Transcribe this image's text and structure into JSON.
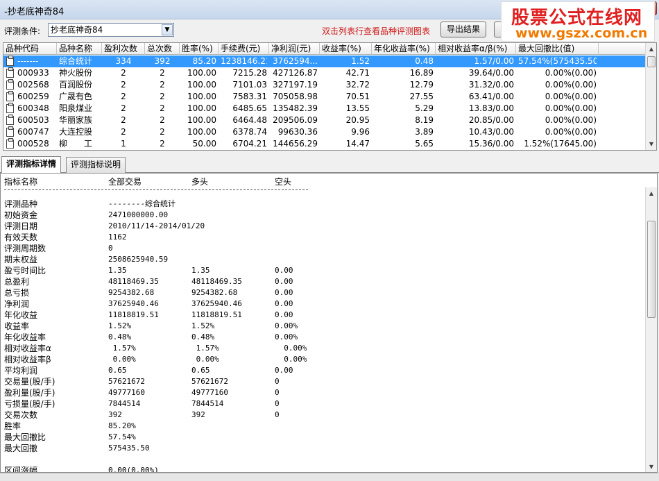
{
  "window": {
    "title": "-抄老底神奇84"
  },
  "watermark": {
    "line1": "股票公式在线网",
    "line2": "www.gszx.com.cn"
  },
  "toolbar": {
    "condition_label": "评测条件:",
    "condition_value": "抄老底神奇84",
    "hint": "双击列表行查看品种评测图表",
    "export_label": "导出结果"
  },
  "grid": {
    "headers": [
      "品种代码",
      "品种名称",
      "盈利次数",
      "总次数",
      "胜率(%)",
      "手续费(元)",
      "净利润(元)",
      "收益率(%)",
      "年化收益率(%)",
      "相对收益率α/β(%)",
      "最大回撤比(值)"
    ],
    "rows": [
      {
        "code": "-------",
        "name": "综合统计",
        "wins": "334",
        "total": "392",
        "rate": "85.20",
        "fee": "1238146.21",
        "profit": "3762594...",
        "ret": "1.52",
        "annual": "0.48",
        "rel": "1.57/0.00",
        "dd": "57.54%(575435.50)",
        "selected": true
      },
      {
        "code": "000933",
        "name": "神火股份",
        "wins": "2",
        "total": "2",
        "rate": "100.00",
        "fee": "7215.28",
        "profit": "427126.87",
        "ret": "42.71",
        "annual": "16.89",
        "rel": "39.64/0.00",
        "dd": "0.00%(0.00)"
      },
      {
        "code": "002568",
        "name": "百润股份",
        "wins": "2",
        "total": "2",
        "rate": "100.00",
        "fee": "7101.03",
        "profit": "327197.19",
        "ret": "32.72",
        "annual": "12.79",
        "rel": "31.32/0.00",
        "dd": "0.00%(0.00)"
      },
      {
        "code": "600259",
        "name": "广晟有色",
        "wins": "2",
        "total": "2",
        "rate": "100.00",
        "fee": "7583.31",
        "profit": "705058.98",
        "ret": "70.51",
        "annual": "27.55",
        "rel": "63.41/0.00",
        "dd": "0.00%(0.00)"
      },
      {
        "code": "600348",
        "name": "阳泉煤业",
        "wins": "2",
        "total": "2",
        "rate": "100.00",
        "fee": "6485.65",
        "profit": "135482.39",
        "ret": "13.55",
        "annual": "5.29",
        "rel": "13.83/0.00",
        "dd": "0.00%(0.00)"
      },
      {
        "code": "600503",
        "name": "华丽家族",
        "wins": "2",
        "total": "2",
        "rate": "100.00",
        "fee": "6464.48",
        "profit": "209506.09",
        "ret": "20.95",
        "annual": "8.19",
        "rel": "20.85/0.00",
        "dd": "0.00%(0.00)"
      },
      {
        "code": "600747",
        "name": "大连控股",
        "wins": "2",
        "total": "2",
        "rate": "100.00",
        "fee": "6378.74",
        "profit": "99630.36",
        "ret": "9.96",
        "annual": "3.89",
        "rel": "10.43/0.00",
        "dd": "0.00%(0.00)"
      },
      {
        "code": "000528",
        "name": "柳　　工",
        "wins": "1",
        "total": "2",
        "rate": "50.00",
        "fee": "6704.21",
        "profit": "144656.29",
        "ret": "14.47",
        "annual": "5.65",
        "rel": "15.36/0.00",
        "dd": "1.52%(17645.00)"
      }
    ]
  },
  "tabs": [
    {
      "label": "评测指标详情",
      "active": true
    },
    {
      "label": "评测指标说明",
      "active": false
    }
  ],
  "detail": {
    "headers": [
      "指标名称",
      "全部交易",
      "多头",
      "空头"
    ],
    "rows": [
      {
        "name": "评测品种",
        "all": "--------综合统计",
        "long": "",
        "short": ""
      },
      {
        "name": "初始资金",
        "all": "2471000000.00",
        "long": "",
        "short": ""
      },
      {
        "name": "评测日期",
        "all": "2010/11/14-2014/01/20",
        "long": "",
        "short": ""
      },
      {
        "name": "有效天数",
        "all": "1162",
        "long": "",
        "short": ""
      },
      {
        "name": "评测周期数",
        "all": "0",
        "long": "",
        "short": ""
      },
      {
        "name": "期末权益",
        "all": "2508625940.59",
        "long": "",
        "short": ""
      },
      {
        "name": "盈亏时间比",
        "all": "1.35",
        "long": "1.35",
        "short": "0.00"
      },
      {
        "name": "总盈利",
        "all": "48118469.35",
        "long": "48118469.35",
        "short": "0.00"
      },
      {
        "name": "总亏损",
        "all": "9254382.68",
        "long": "9254382.68",
        "short": "0.00"
      },
      {
        "name": "净利润",
        "all": "37625940.46",
        "long": "37625940.46",
        "short": "0.00"
      },
      {
        "name": "年化收益",
        "all": "11818819.51",
        "long": "11818819.51",
        "short": "0.00"
      },
      {
        "name": "收益率",
        "all": "1.52%",
        "long": "1.52%",
        "short": "0.00%"
      },
      {
        "name": "年化收益率",
        "all": "0.48%",
        "long": "0.48%",
        "short": "0.00%"
      },
      {
        "name": "相对收益率α",
        "all": " 1.57%",
        "long": " 1.57%",
        "short": "  0.00%"
      },
      {
        "name": "相对收益率β",
        "all": " 0.00%",
        "long": " 0.00%",
        "short": "  0.00%"
      },
      {
        "name": "平均利润",
        "all": "0.65",
        "long": "0.65",
        "short": "0.00"
      },
      {
        "name": "交易量(股/手)",
        "all": "57621672",
        "long": "57621672",
        "short": "0"
      },
      {
        "name": "盈利量(股/手)",
        "all": "49777160",
        "long": "49777160",
        "short": "0"
      },
      {
        "name": "亏损量(股/手)",
        "all": "7844514",
        "long": "7844514",
        "short": "0"
      },
      {
        "name": "交易次数",
        "all": "392",
        "long": "392",
        "short": "0"
      },
      {
        "name": "胜率",
        "all": "85.20%",
        "long": "",
        "short": ""
      },
      {
        "name": "最大回撤比",
        "all": "57.54%",
        "long": "",
        "short": ""
      },
      {
        "name": "最大回撤",
        "all": "575435.50",
        "long": "",
        "short": ""
      },
      {
        "name": "",
        "all": "",
        "long": "",
        "short": ""
      },
      {
        "name": "区间涨幅",
        "all": "0.00(0.00%)",
        "long": "",
        "short": ""
      }
    ]
  },
  "colors": {
    "selection": "#3399ff",
    "hint": "#d01a1a",
    "watermark_red": "#e02020",
    "watermark_orange": "#f07a00"
  }
}
